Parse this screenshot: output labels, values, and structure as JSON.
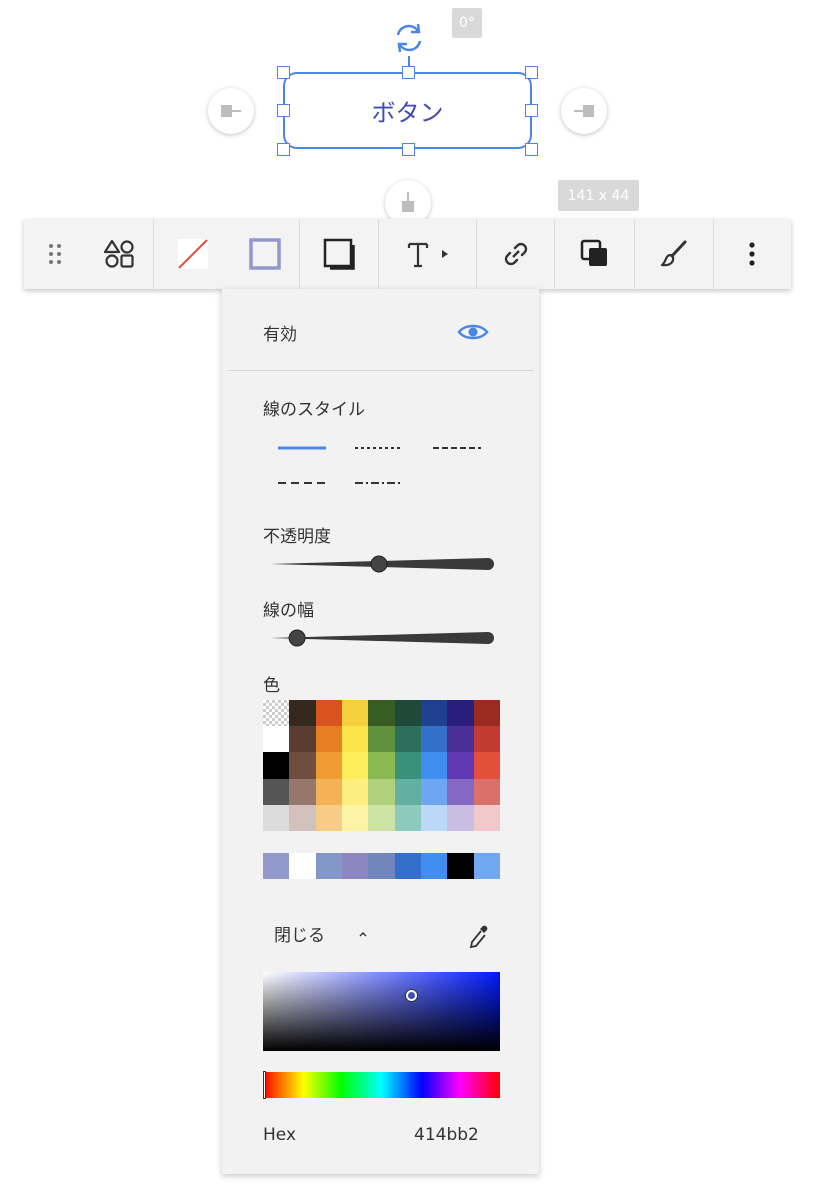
{
  "canvas": {
    "shape_label": "ボタン",
    "rotation_badge": "0°",
    "size_badge": "141 x 44"
  },
  "toolbar": {
    "buttons": [
      "drag-handle-icon",
      "shapes-icon",
      "fill-none-icon",
      "border-color-icon",
      "border-style-icon",
      "text-icon",
      "link-icon",
      "layer-order-icon",
      "style-brush-icon",
      "more-vertical-icon"
    ]
  },
  "panel": {
    "enabled_label": "有効",
    "line_style_label": "線のスタイル",
    "opacity_label": "不透明度",
    "opacity_value": 0.5,
    "line_width_label": "線の幅",
    "line_width_value": 0.11,
    "color_label": "色",
    "close_label": "閉じる",
    "hex_label": "Hex",
    "hex_value": "414bb2",
    "line_styles": [
      "solid",
      "dotted",
      "dashed",
      "long-dashed",
      "dash-dot"
    ],
    "selected_line_style": "solid",
    "palette": [
      [
        "transparent",
        "#35291f",
        "#d8531d",
        "#f5d03f",
        "#375c24",
        "#1f4a3a",
        "#1f3f8f",
        "#291d7d",
        "#9b2a21"
      ],
      [
        "#ffffff",
        "#5a3d30",
        "#e67e22",
        "#fbe54a",
        "#5f903c",
        "#2b6f5c",
        "#3470cb",
        "#4a2f97",
        "#c23a30"
      ],
      [
        "#000000",
        "#6f4d3f",
        "#ef9c32",
        "#fced5b",
        "#8cb851",
        "#39917b",
        "#3f8ef0",
        "#613ab3",
        "#e24f3b"
      ],
      [
        "#555555",
        "#95776b",
        "#f4b256",
        "#fcef80",
        "#b0d07c",
        "#62b0a0",
        "#6ea6f3",
        "#8567c4",
        "#d9716a"
      ],
      [
        "#dcdcdc",
        "#d2c2bb",
        "#f7cc86",
        "#fcf3a4",
        "#cde3a6",
        "#8ec9bd",
        "#bdd7f7",
        "#c9bde2",
        "#f2c9cb"
      ]
    ],
    "recent_colors": [
      "#9199cb",
      "#ffffff",
      "#8497c9",
      "#8d86bf",
      "#7285bd",
      "#3470cb",
      "#3f8ef0",
      "#000000",
      "#70a9f1"
    ],
    "sv_saturation": 0.63,
    "sv_value": 0.7,
    "hue": 0.65,
    "accent_color": "#4a86e8",
    "shape_text_color": "#414bb2"
  }
}
